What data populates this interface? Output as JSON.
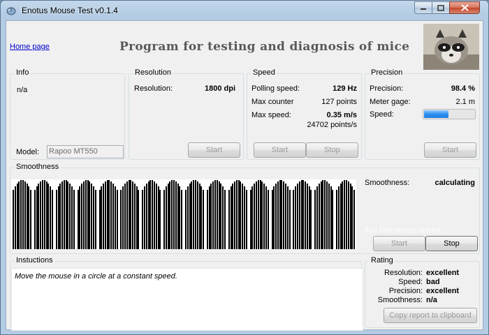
{
  "window": {
    "title": "Enotus Mouse Test v0.1.4"
  },
  "header": {
    "home_link": "Home page",
    "heading": "Program for testing and diagnosis of mice"
  },
  "info": {
    "legend": "Info",
    "value": "n/a",
    "model_label": "Model:",
    "model_value": "Rapoo MT550"
  },
  "resolution": {
    "legend": "Resolution",
    "label": "Resolution:",
    "value": "1800 dpi",
    "start": "Start"
  },
  "speed": {
    "legend": "Speed",
    "polling_label": "Polling speed:",
    "polling_value": "129 Hz",
    "counter_label": "Max counter",
    "counter_value": "127 points",
    "maxspeed_label": "Max  speed:",
    "maxspeed_value": "0.35 m/s",
    "maxspeed_points": "24702 points/s",
    "start": "Start",
    "stop": "Stop"
  },
  "precision": {
    "legend": "Precision",
    "precision_label": "Precision:",
    "precision_value": "98.4 %",
    "gage_label": "Meter gage:",
    "gage_value": "2.1 m",
    "speed_label": "Speed:",
    "speed_fraction": 0.48,
    "start": "Start"
  },
  "smoothness": {
    "legend": "Smoothness",
    "label": "Smoothness:",
    "value": "calculating",
    "warning": "Too fast mouse speed ...",
    "start": "Start",
    "stop": "Stop",
    "graph": {
      "groups": 16,
      "bars_per_group": 10,
      "min_level": 0.74,
      "max_level": 0.99
    }
  },
  "instructions": {
    "legend": "Instuctions",
    "text": "Move the mouse in a circle at a constant speed."
  },
  "rating": {
    "legend": "Rating",
    "items": [
      {
        "label": "Resolution:",
        "value": "excellent"
      },
      {
        "label": "Speed:",
        "value": "bad"
      },
      {
        "label": "Precision:",
        "value": "excellent"
      },
      {
        "label": "Smoothness:",
        "value": "n/a"
      }
    ],
    "copy_button": "Copy report to clipboard"
  }
}
